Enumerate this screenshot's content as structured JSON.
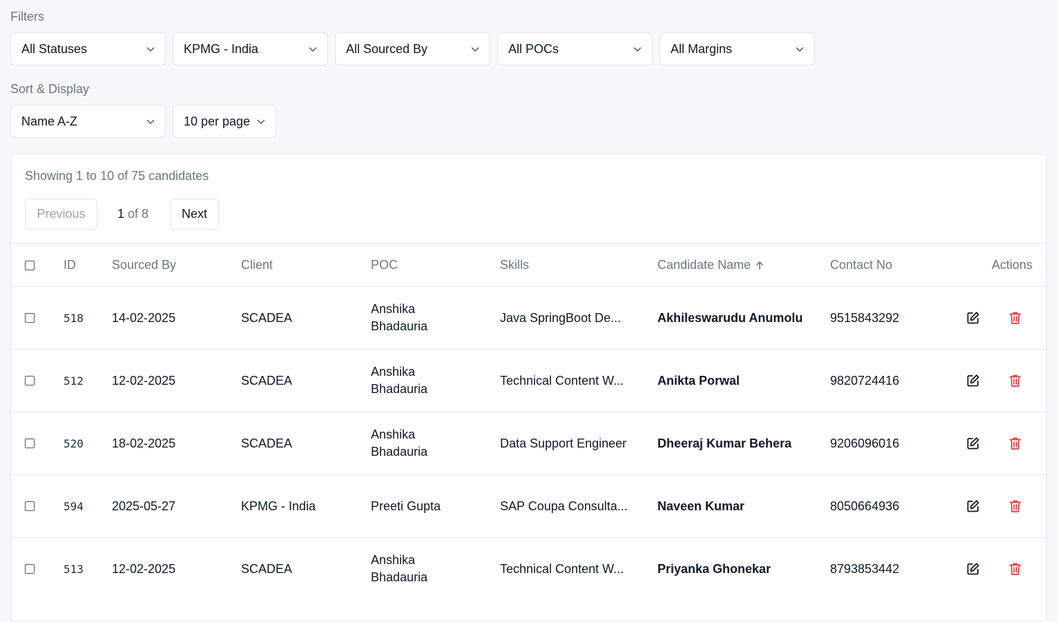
{
  "filters": {
    "label": "Filters",
    "status": "All Statuses",
    "client": "KPMG - India",
    "sourced_by": "All Sourced By",
    "pocs": "All POCs",
    "margins": "All Margins"
  },
  "sort_display": {
    "label": "Sort & Display",
    "sort": "Name A-Z",
    "per_page": "10 per page"
  },
  "results": {
    "showing": "Showing 1 to 10 of 75 candidates"
  },
  "pagination": {
    "previous": "Previous",
    "current": "1",
    "of_total": " of 8",
    "next": "Next"
  },
  "table": {
    "columns": {
      "id": "ID",
      "sourced_by": "Sourced By",
      "client": "Client",
      "poc": "POC",
      "skills": "Skills",
      "candidate_name": "Candidate Name",
      "contact_no": "Contact No",
      "actions": "Actions"
    },
    "rows": [
      {
        "id": "518",
        "sourced": "14-02-2025",
        "client": "SCADEA",
        "poc_1": "Anshika",
        "poc_2": "Bhadauria",
        "skills": "Java SpringBoot De...",
        "name": "Akhileswarudu Anumolu",
        "contact": "9515843292"
      },
      {
        "id": "512",
        "sourced": "12-02-2025",
        "client": "SCADEA",
        "poc_1": "Anshika",
        "poc_2": "Bhadauria",
        "skills": "Technical Content W...",
        "name": "Anikta Porwal",
        "contact": "9820724416"
      },
      {
        "id": "520",
        "sourced": "18-02-2025",
        "client": "SCADEA",
        "poc_1": "Anshika",
        "poc_2": "Bhadauria",
        "skills": "Data Support Engineer",
        "name": "Dheeraj Kumar Behera",
        "contact": "9206096016"
      },
      {
        "id": "594",
        "sourced": "2025-05-27",
        "client": "KPMG - India",
        "poc_1": "Preeti Gupta",
        "poc_2": "",
        "skills": "SAP Coupa Consulta...",
        "name": "Naveen Kumar",
        "contact": "8050664936"
      },
      {
        "id": "513",
        "sourced": "12-02-2025",
        "client": "SCADEA",
        "poc_1": "Anshika",
        "poc_2": "Bhadauria",
        "skills": "Technical Content W...",
        "name": "Priyanka Ghonekar",
        "contact": "8793853442"
      }
    ]
  },
  "icons": {
    "dropdown": "chevron-down-icon",
    "sort": "arrow-up-icon",
    "edit": "edit-icon",
    "delete": "trash-icon"
  },
  "colors": {
    "background": "#f7f8fa",
    "muted_text": "#6b7685",
    "delete": "#e0393e",
    "border": "#dfe3e8"
  }
}
